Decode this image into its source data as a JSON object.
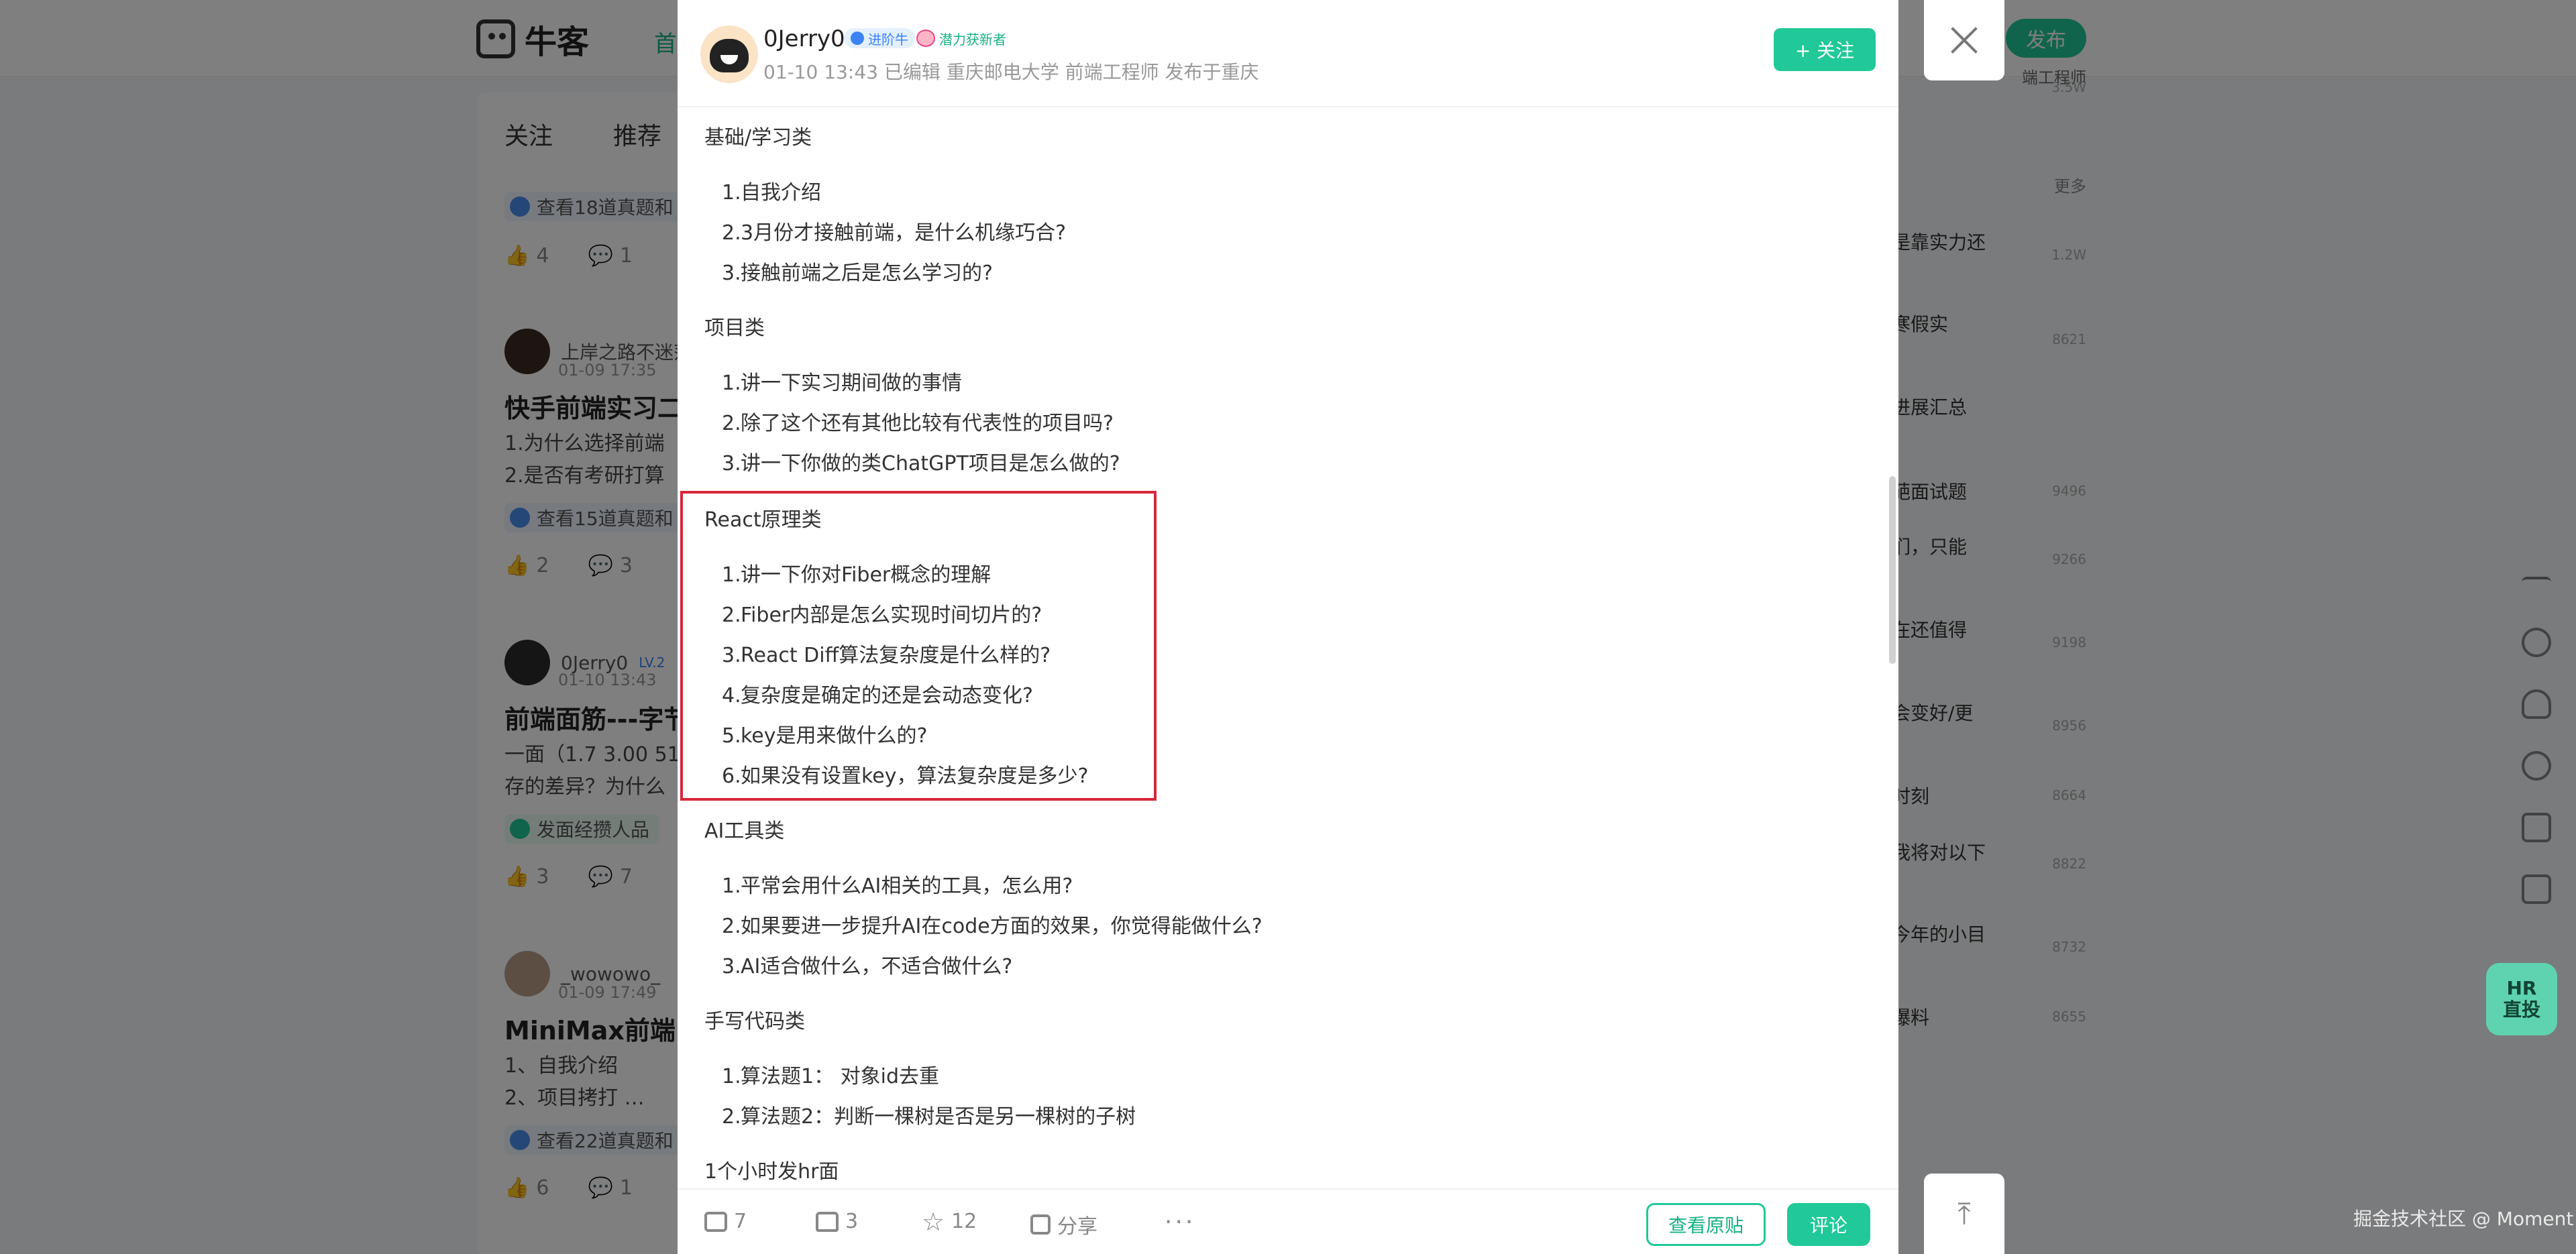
{
  "background": {
    "logo_text": "牛客",
    "nav_first": "首",
    "publish_label": "发布",
    "tabs": [
      "关注",
      "推荐"
    ],
    "feed": [
      {
        "chip": "查看18道真题和",
        "likes": "4",
        "comments": "1"
      },
      {
        "author": "上岸之路不迷茫",
        "time": "01-09 17:35",
        "title": "快手前端实习二面",
        "lines": [
          "1.为什么选择前端",
          "2.是否有考研打算"
        ],
        "chip": "查看15道真题和",
        "likes": "2",
        "comments": "3"
      },
      {
        "author": "0Jerry0",
        "level": "LV.2",
        "time": "01-10 13:43",
        "title": "前端面筋---字节",
        "lines": [
          "一面（1.7 3.00 51",
          "存的差异？为什么"
        ],
        "chip": "发面经攒人品",
        "likes": "3",
        "comments": "7"
      },
      {
        "author": "_wowowo_",
        "time": "01-09 17:49",
        "title": "MiniMax前端日",
        "lines": [
          "1、自我介绍",
          "2、项目拷打 …"
        ],
        "chip": "查看22道真题和",
        "likes": "6",
        "comments": "1"
      }
    ],
    "side_top": "端工程师",
    "side_top_meta": "3.5W",
    "side_more": "更多",
    "side_items": [
      {
        "text": "是靠实力还",
        "meta": "1.2W"
      },
      {
        "text": "寒假实",
        "meta": "8621"
      },
      {
        "text": "进展汇总",
        "meta": ""
      },
      {
        "text": "葩面试题",
        "meta": "9496"
      },
      {
        "text": "们，只能",
        "meta": "9266"
      },
      {
        "text": "在还值得",
        "meta": "9198"
      },
      {
        "text": "会变好/更",
        "meta": "8956"
      },
      {
        "text": "时刻",
        "meta": "8664"
      },
      {
        "text": "我将对以下",
        "meta": "8822"
      },
      {
        "text": "今年的小目",
        "meta": "8732"
      },
      {
        "text": "爆料",
        "meta": "8655"
      }
    ],
    "hr_badge": [
      "HR",
      "直投"
    ],
    "watermark": "掘金技术社区 @ Moment"
  },
  "modal": {
    "author": "0Jerry0",
    "level_badge": "进阶牛",
    "new_badge": "潜力获新者",
    "meta": "01-10 13:43  已编辑  重庆邮电大学 前端工程师  发布于重庆",
    "follow_label": "+ 关注",
    "sections": [
      {
        "title": "基础/学习类",
        "items": [
          "自我介绍",
          "3月份才接触前端，是什么机缘巧合?",
          "接触前端之后是怎么学习的?"
        ]
      },
      {
        "title": "项目类",
        "items": [
          "讲一下实习期间做的事情",
          "除了这个还有其他比较有代表性的项目吗?",
          "讲一下你做的类ChatGPT项目是怎么做的?"
        ]
      },
      {
        "title": "React原理类",
        "items": [
          "讲一下你对Fiber概念的理解",
          "Fiber内部是怎么实现时间切片的?",
          "React Diff算法复杂度是什么样的?",
          "复杂度是确定的还是会动态变化?",
          "key是用来做什么的?",
          "如果没有设置key，算法复杂度是多少?"
        ]
      },
      {
        "title": "AI工具类",
        "items": [
          "平常会用什么AI相关的工具，怎么用?",
          "如果要进一步提升AI在code方面的效果，你觉得能做什么?",
          "AI适合做什么，不适合做什么?"
        ]
      },
      {
        "title": "手写代码类",
        "items": [
          "算法题1： 对象id去重",
          "算法题2：判断一棵树是否是另一棵树的子树"
        ]
      },
      {
        "title": "1个小时发hr面",
        "items": []
      }
    ],
    "footer": {
      "comments": "7",
      "likes": "3",
      "stars": "12",
      "share": "分享",
      "more": "···",
      "view_original": "查看原贴",
      "comment_label": "评论"
    }
  }
}
